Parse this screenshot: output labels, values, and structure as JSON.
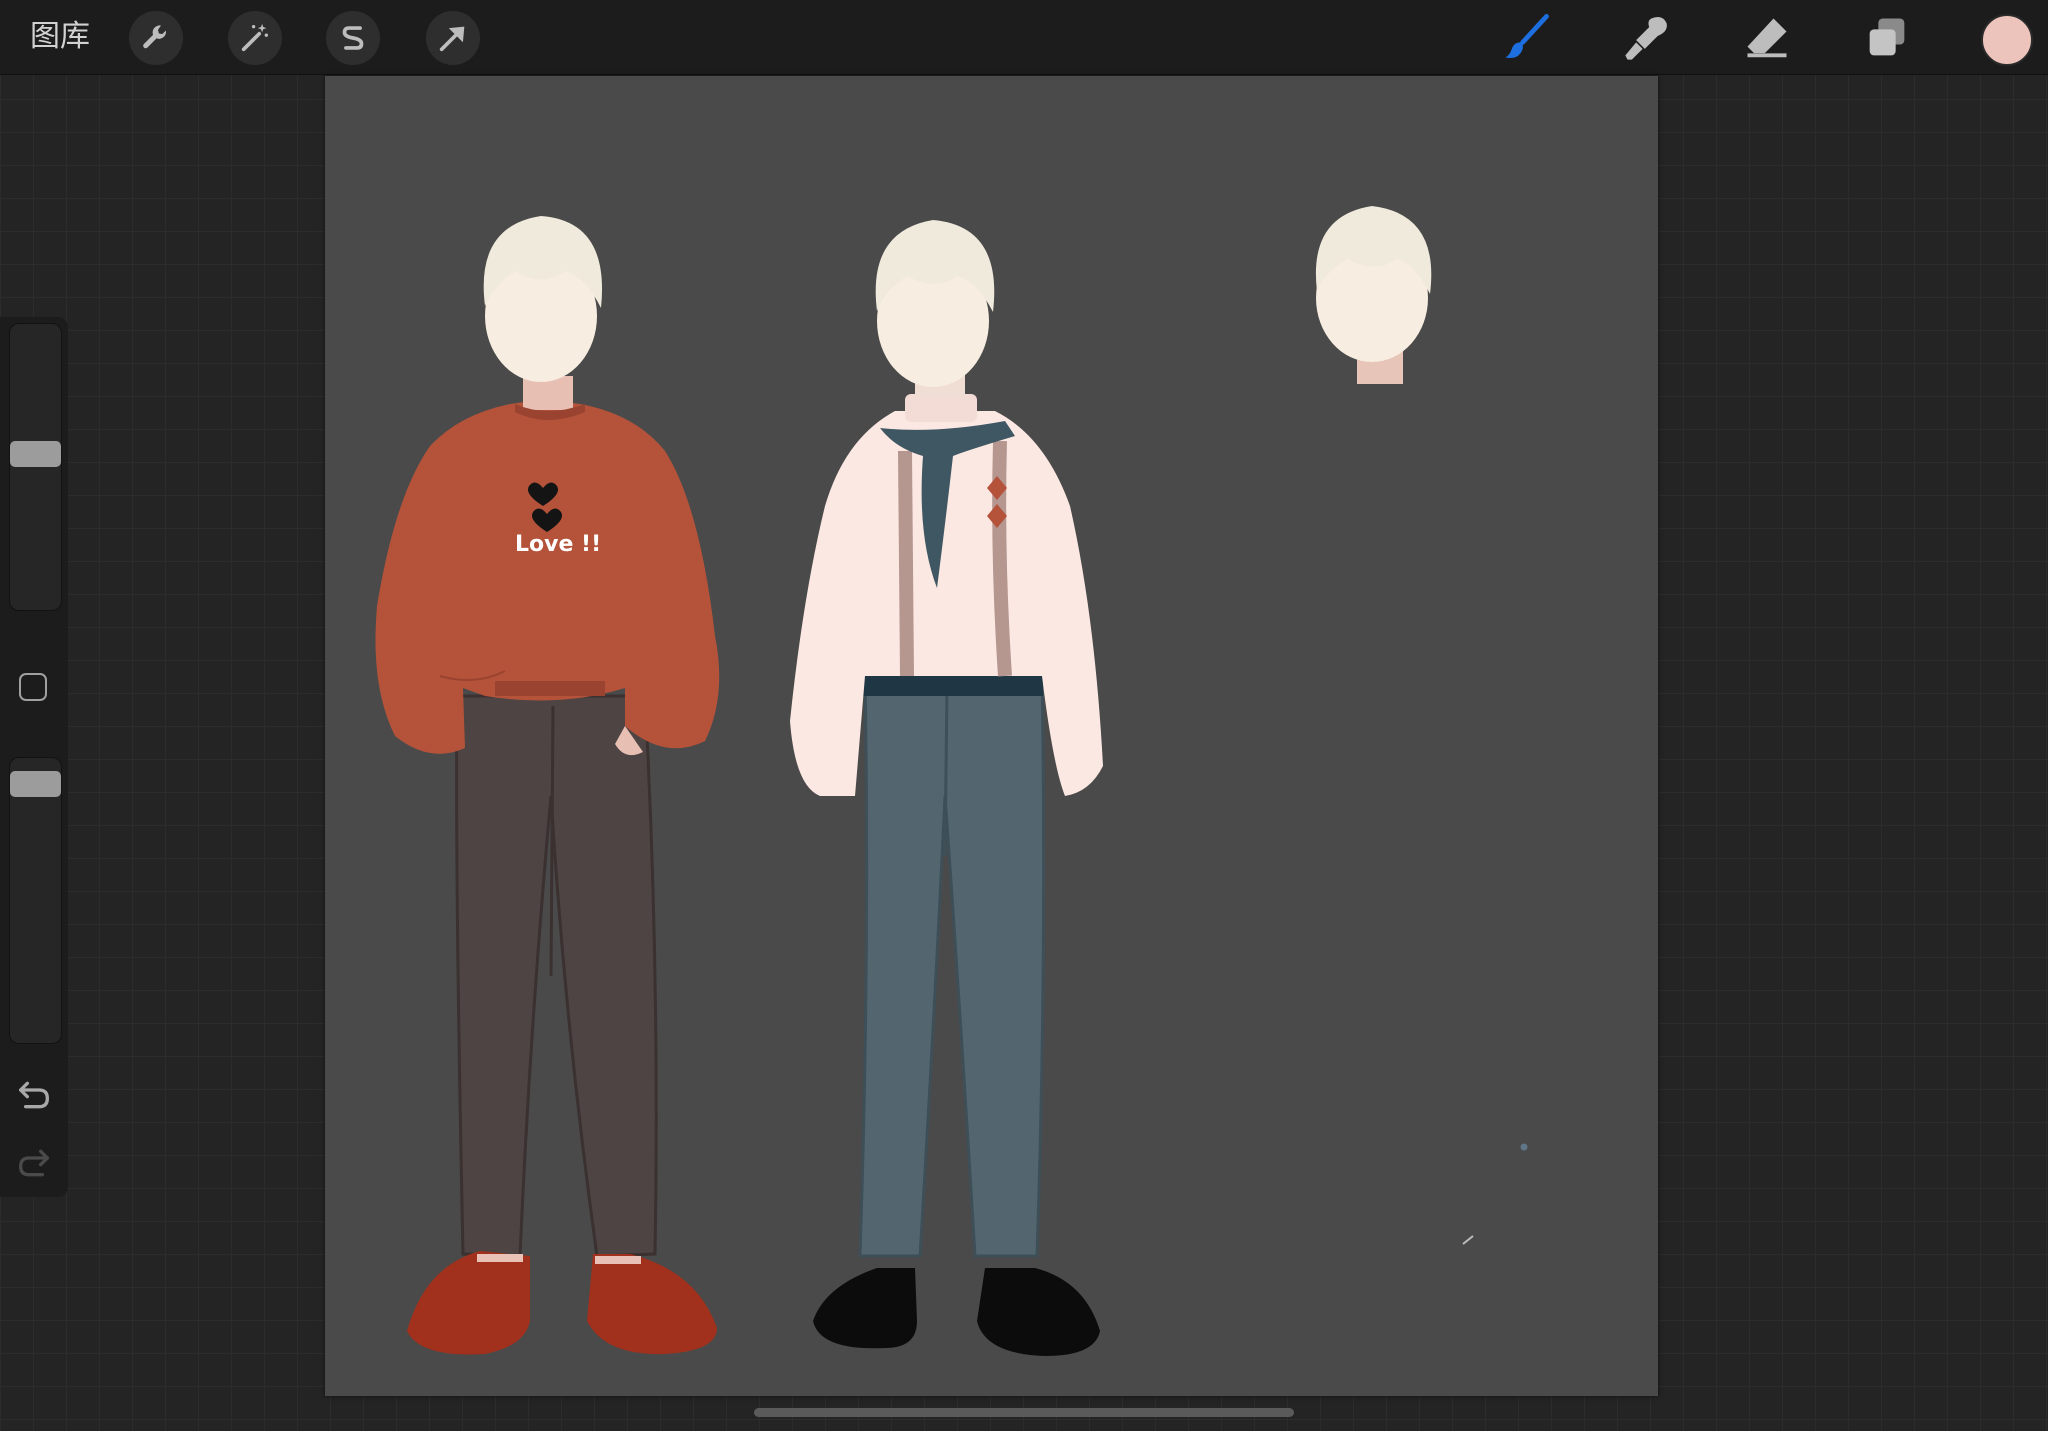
{
  "toolbar": {
    "gallery_label": "图库",
    "left_tools": [
      {
        "name": "actions",
        "icon": "wrench-icon"
      },
      {
        "name": "adjustments",
        "icon": "magic-wand-icon"
      },
      {
        "name": "selection",
        "icon": "selection-s-icon"
      },
      {
        "name": "transform",
        "icon": "arrow-cursor-icon"
      }
    ],
    "right_tools": [
      {
        "name": "brush",
        "icon": "brush-icon",
        "active": true
      },
      {
        "name": "smudge",
        "icon": "smudge-icon"
      },
      {
        "name": "eraser",
        "icon": "eraser-icon"
      },
      {
        "name": "layers",
        "icon": "layers-icon"
      }
    ],
    "active_color": "#ecc4bb",
    "accent_color": "#1d6fe0"
  },
  "sidebar": {
    "brush_size_level": 0.55,
    "opacity_level": 0.95,
    "modify_icon": "square-icon",
    "undo_icon": "undo-icon",
    "redo_icon": "redo-icon"
  },
  "canvas": {
    "background": "#4a4a4a",
    "artwork_text": "Love !!"
  }
}
